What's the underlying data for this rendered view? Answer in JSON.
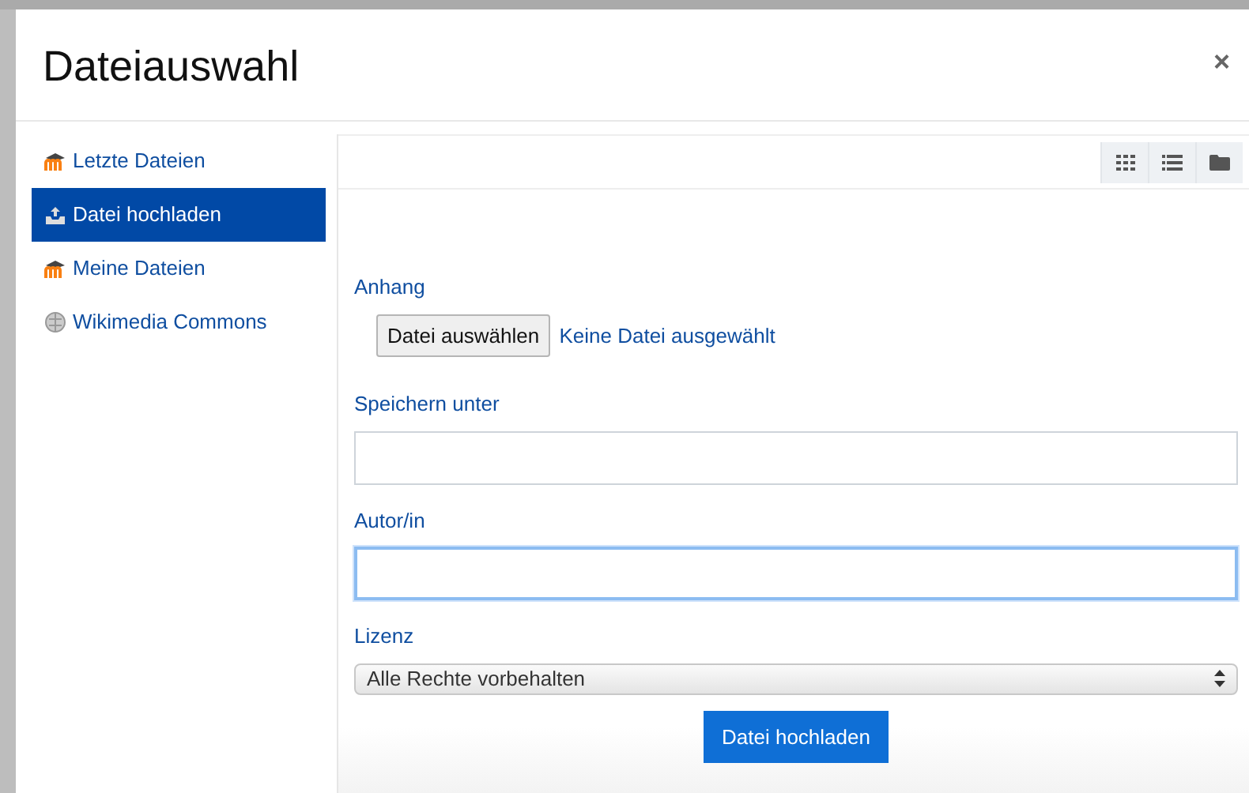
{
  "window": {
    "title": "Dateiauswahl",
    "close": "×"
  },
  "sidebar": {
    "items": [
      {
        "label": "Letzte Dateien",
        "kind": "moodle",
        "selected": false
      },
      {
        "label": "Datei hochladen",
        "kind": "upload",
        "selected": true
      },
      {
        "label": "Meine Dateien",
        "kind": "moodle",
        "selected": false
      },
      {
        "label": "Wikimedia Commons",
        "kind": "wiki",
        "selected": false
      }
    ]
  },
  "toolbar": {
    "views": [
      {
        "kind": "grid"
      },
      {
        "kind": "list"
      },
      {
        "kind": "folder"
      }
    ]
  },
  "form": {
    "fields": [
      {
        "kind": "file",
        "label": "Anhang",
        "button": "Datei auswählen",
        "value": "Keine Datei ausgewählt"
      },
      {
        "kind": "text",
        "label": "Speichern unter",
        "focused": false
      },
      {
        "kind": "text",
        "label": "Autor/in",
        "focused": true
      },
      {
        "kind": "select",
        "label": "Lizenz",
        "value": "Alle Rechte vorbehalten"
      }
    ],
    "submit": "Datei hochladen"
  }
}
